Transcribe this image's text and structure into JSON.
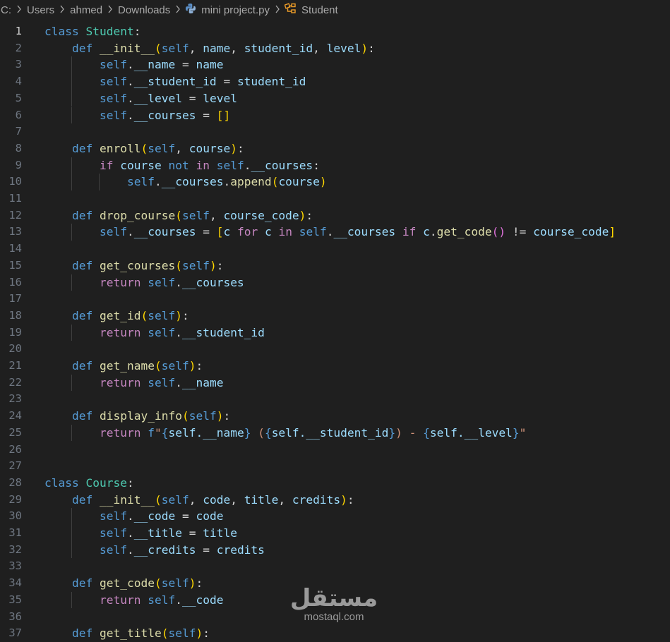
{
  "breadcrumb": {
    "items": [
      "C:",
      "Users",
      "ahmed",
      "Downloads",
      "mini project.py",
      "Student"
    ],
    "separator_icon": "chevron-right-icon",
    "file_icon": "python-file-icon",
    "symbol_icon": "class-symbol-icon"
  },
  "editor": {
    "language": "python",
    "active_line": 1,
    "line_numbers": [
      "1",
      "2",
      "3",
      "4",
      "5",
      "6",
      "7",
      "8",
      "9",
      "10",
      "11",
      "12",
      "13",
      "14",
      "15",
      "16",
      "17",
      "18",
      "19",
      "20",
      "21",
      "22",
      "23",
      "24",
      "25",
      "26",
      "27",
      "28",
      "29",
      "30",
      "31",
      "32",
      "33",
      "34",
      "35",
      "36",
      "37"
    ],
    "lines": [
      "class Student:",
      "    def __init__(self, name, student_id, level):",
      "        self.__name = name",
      "        self.__student_id = student_id",
      "        self.__level = level",
      "        self.__courses = []",
      "",
      "    def enroll(self, course):",
      "        if course not in self.__courses:",
      "            self.__courses.append(course)",
      "",
      "    def drop_course(self, course_code):",
      "        self.__courses = [c for c in self.__courses if c.get_code() != course_code]",
      "",
      "    def get_courses(self):",
      "        return self.__courses",
      "",
      "    def get_id(self):",
      "        return self.__student_id",
      "",
      "    def get_name(self):",
      "        return self.__name",
      "",
      "    def display_info(self):",
      "        return f\"{self.__name} ({self.__student_id}) - {self.__level}\"",
      "",
      "",
      "class Course:",
      "    def __init__(self, code, title, credits):",
      "        self.__code = code",
      "        self.__title = title",
      "        self.__credits = credits",
      "",
      "    def get_code(self):",
      "        return self.__code",
      "",
      "    def get_title(self):"
    ]
  },
  "watermark": {
    "arabic": "مستقل",
    "latin": "mostaql.com"
  },
  "colors": {
    "background": "#1f1f1f",
    "keyword": "#569cd6",
    "control": "#c586c0",
    "class_name": "#4ec9b0",
    "function": "#dcdcaa",
    "variable": "#9cdcfe",
    "string": "#ce9178",
    "bracket_1": "#ffd700",
    "bracket_2": "#da70d6",
    "bracket_3": "#179fff",
    "line_number": "#6e7681"
  }
}
